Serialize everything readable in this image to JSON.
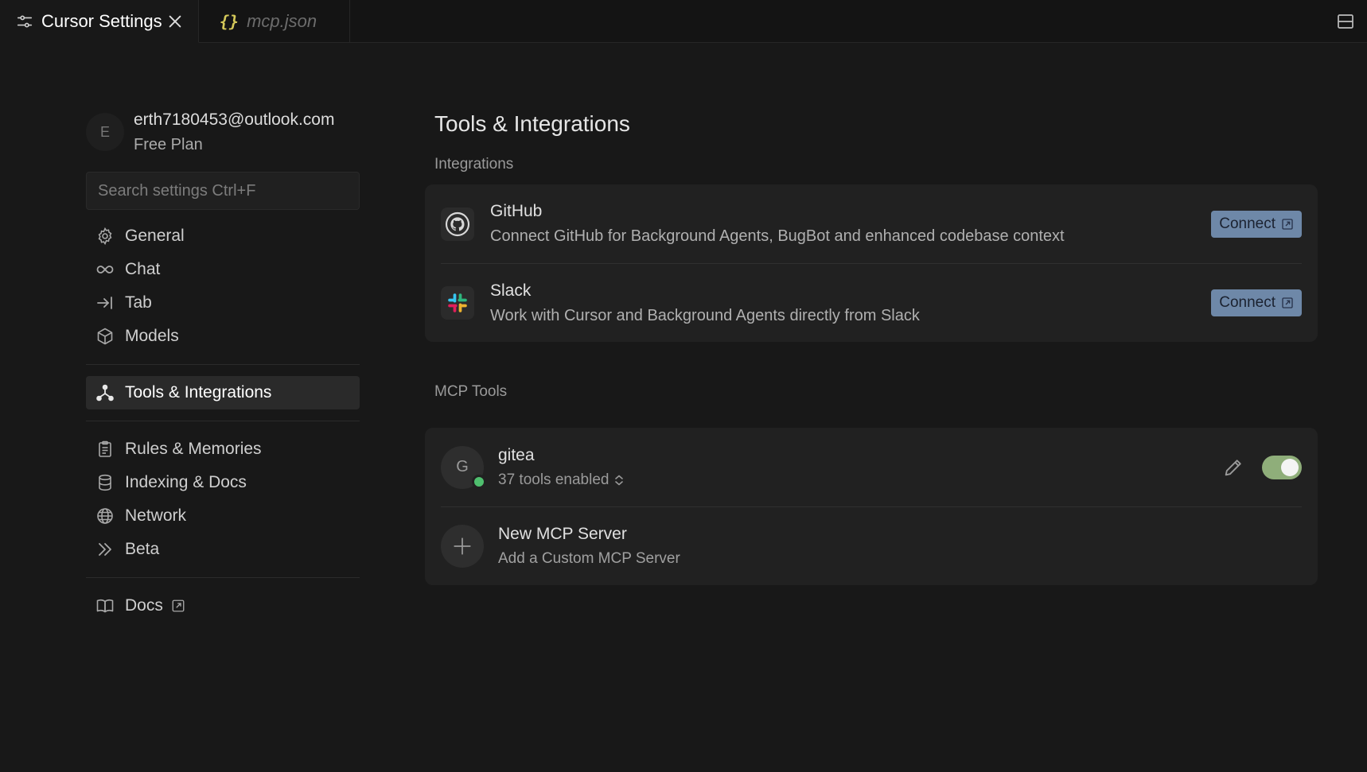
{
  "tabs": [
    {
      "label": "Cursor Settings",
      "icon": "sliders-icon",
      "active": true
    },
    {
      "label": "mcp.json",
      "icon": "json-braces-icon",
      "glyph": "{}",
      "active": false
    }
  ],
  "account": {
    "initial": "E",
    "email": "erth7180453@outlook.com",
    "plan": "Free Plan"
  },
  "search": {
    "placeholder": "Search settings Ctrl+F"
  },
  "nav": {
    "general": "General",
    "chat": "Chat",
    "tab": "Tab",
    "models": "Models",
    "tools": "Tools & Integrations",
    "rules": "Rules & Memories",
    "indexing": "Indexing & Docs",
    "network": "Network",
    "beta": "Beta",
    "docs": "Docs"
  },
  "main": {
    "title": "Tools & Integrations",
    "integrations_label": "Integrations",
    "integrations": [
      {
        "name": "GitHub",
        "description": "Connect GitHub for Background Agents, BugBot and enhanced codebase context",
        "action": "Connect"
      },
      {
        "name": "Slack",
        "description": "Work with Cursor and Background Agents directly from Slack",
        "action": "Connect"
      }
    ],
    "mcp_label": "MCP Tools",
    "mcp_servers": [
      {
        "initial": "G",
        "name": "gitea",
        "tools": "37 tools enabled",
        "enabled": true,
        "status_color": "#4fbf6e"
      }
    ],
    "new_server": {
      "title": "New MCP Server",
      "subtitle": "Add a Custom MCP Server"
    }
  },
  "colors": {
    "accent_button": "#6e88a8",
    "toggle_on": "#8fae7a",
    "status_ok": "#4fbf6e"
  }
}
